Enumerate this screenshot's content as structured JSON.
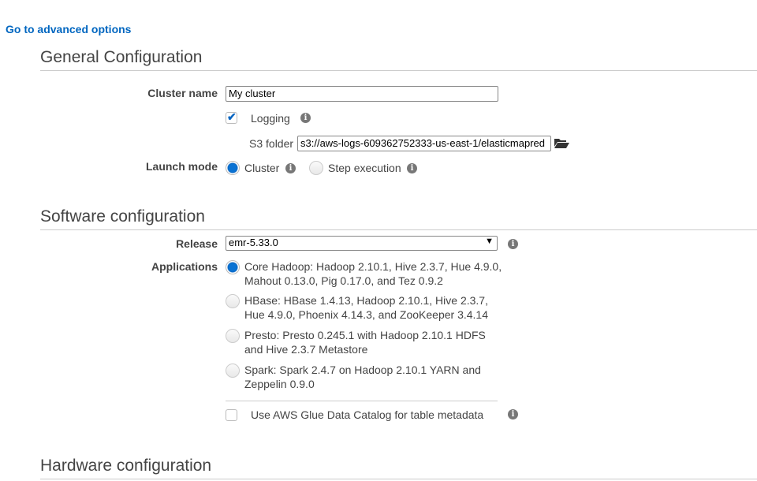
{
  "advanced_link": "Go to advanced options",
  "general": {
    "title": "General Configuration",
    "cluster_name_label": "Cluster name",
    "cluster_name_value": "My cluster",
    "logging_label": "Logging",
    "logging_checked": true,
    "s3_label": "S3 folder",
    "s3_value": "s3://aws-logs-609362752333-us-east-1/elasticmapred",
    "launch_mode_label": "Launch mode",
    "launch_modes": [
      {
        "label": "Cluster",
        "selected": true
      },
      {
        "label": "Step execution",
        "selected": false
      }
    ]
  },
  "software": {
    "title": "Software configuration",
    "release_label": "Release",
    "release_value": "emr-5.33.0",
    "applications_label": "Applications",
    "applications": [
      {
        "line1": "Core Hadoop: Hadoop 2.10.1, Hive 2.3.7, Hue 4.9.0,",
        "line2": "Mahout 0.13.0, Pig 0.17.0, and Tez 0.9.2",
        "selected": true
      },
      {
        "line1": "HBase: HBase 1.4.13, Hadoop 2.10.1, Hive 2.3.7,",
        "line2": "Hue 4.9.0, Phoenix 4.14.3, and ZooKeeper 3.4.14",
        "selected": false
      },
      {
        "line1": "Presto: Presto 0.245.1 with Hadoop 2.10.1 HDFS",
        "line2": "and Hive 2.3.7 Metastore",
        "selected": false
      },
      {
        "line1": "Spark: Spark 2.4.7 on Hadoop 2.10.1 YARN and",
        "line2": "Zeppelin 0.9.0",
        "selected": false
      }
    ],
    "glue_label": "Use AWS Glue Data Catalog for table metadata",
    "glue_checked": false
  },
  "hardware": {
    "title": "Hardware configuration"
  },
  "info_glyph": "i"
}
